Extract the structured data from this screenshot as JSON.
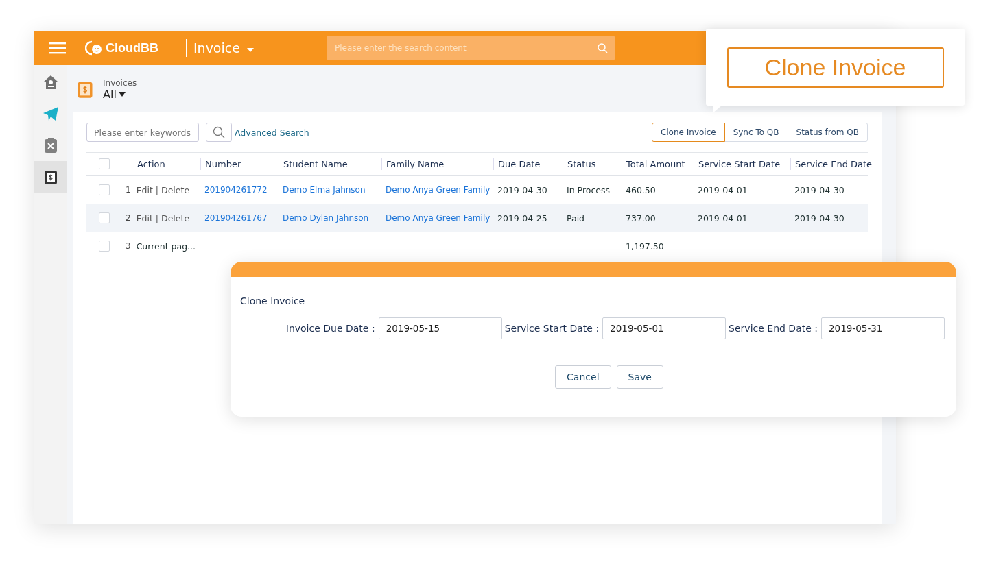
{
  "header": {
    "logo_text": "CloudBB",
    "module": "Invoice",
    "search": {
      "placeholder": "Please enter the search content"
    }
  },
  "sidebar": {
    "items": [
      {
        "kind": "home",
        "selected": false
      },
      {
        "kind": "send",
        "selected": false
      },
      {
        "kind": "tools",
        "selected": false
      },
      {
        "kind": "invoice",
        "selected": true
      }
    ]
  },
  "page": {
    "subtitle": "Invoices",
    "view": "All"
  },
  "toolbar": {
    "keyword_search": {
      "placeholder": "Please enter keywords"
    },
    "advanced_search": "Advanced Search",
    "buttons": [
      {
        "label": "Clone Invoice",
        "selected": true
      },
      {
        "label": "Sync To QB",
        "selected": false
      },
      {
        "label": "Status from QB",
        "selected": false
      }
    ]
  },
  "table": {
    "header_checked": false,
    "columns": [
      {
        "label": "Action",
        "kind": "text"
      },
      {
        "label": "Number",
        "kind": "link"
      },
      {
        "label": "Student Name",
        "kind": "link"
      },
      {
        "label": "Family Name",
        "kind": "link"
      },
      {
        "label": "Due Date",
        "kind": "text"
      },
      {
        "label": "Status",
        "kind": "text"
      },
      {
        "label": "Total Amount",
        "kind": "text"
      },
      {
        "label": "Service Start Date",
        "kind": "text"
      },
      {
        "label": "Service End Date",
        "kind": "text"
      }
    ],
    "rows": [
      {
        "kind": "data",
        "index": "1",
        "checked": false,
        "highlighted": false,
        "cells": [
          "Edit | Delete",
          "201904261772",
          "Demo Elma Jahnson",
          "Demo Anya Green Family",
          "2019-04-30",
          "In Process",
          "460.50",
          "2019-04-01",
          "2019-04-30"
        ]
      },
      {
        "kind": "data",
        "index": "2",
        "checked": false,
        "highlighted": true,
        "cells": [
          "Edit | Delete",
          "201904261767",
          "Demo Dylan Jahnson",
          "Demo Anya Green Family",
          "2019-04-25",
          "Paid",
          "737.00",
          "2019-04-01",
          "2019-04-30"
        ]
      },
      {
        "kind": "summary",
        "index": "3",
        "checked": false,
        "highlighted": false,
        "label": "Current pag...",
        "total": "1,197.50"
      }
    ]
  },
  "callout": {
    "label": "Clone Invoice"
  },
  "dialog": {
    "title": "Clone Invoice",
    "fields": [
      {
        "label": "Invoice Due Date :",
        "value": "2019-05-15"
      },
      {
        "label": "Service Start Date :",
        "value": "2019-05-01"
      },
      {
        "label": "Service End Date :",
        "value": "2019-05-31"
      }
    ],
    "buttons": [
      "Cancel",
      "Save"
    ]
  }
}
